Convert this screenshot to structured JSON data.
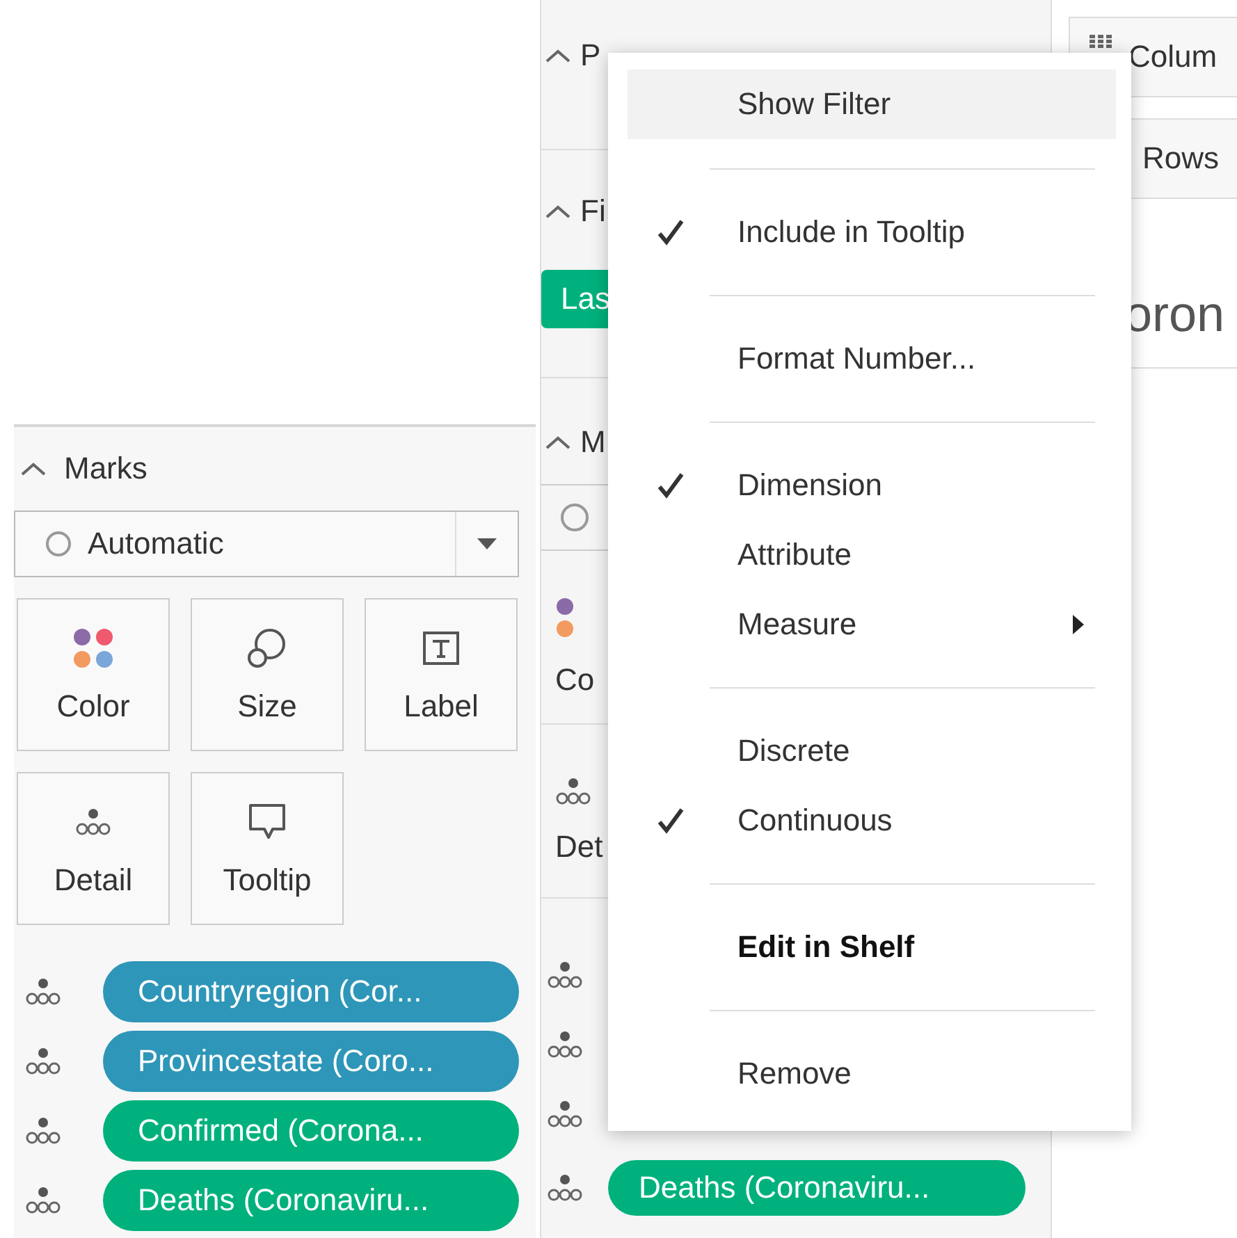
{
  "marks_panel": {
    "title": "Marks",
    "mark_type": "Automatic",
    "cards": [
      {
        "kind": "color",
        "label": "Color"
      },
      {
        "kind": "size",
        "label": "Size"
      },
      {
        "kind": "label",
        "label": "Label"
      },
      {
        "kind": "detail",
        "label": "Detail"
      },
      {
        "kind": "tooltip",
        "label": "Tooltip"
      }
    ],
    "pills": [
      {
        "text": "Countryregion (Cor...",
        "color": "#2e96b8"
      },
      {
        "text": "Provincestate (Coro...",
        "color": "#2e96b8"
      },
      {
        "text": "Confirmed (Corona...",
        "color": "#00b17d"
      },
      {
        "text": "Deaths (Coronaviru...",
        "color": "#00b17d"
      }
    ]
  },
  "background": {
    "pages_title": "P",
    "filters_title": "Fi",
    "filter_pill": "Las",
    "marks_title": "M",
    "cards": [
      {
        "kind": "color",
        "label": "Co"
      },
      {
        "kind": "detail",
        "label": "Det"
      }
    ],
    "pills": [
      {
        "text": "Deaths (Coronaviru...",
        "color": "#00b17d"
      }
    ],
    "shelves": [
      {
        "kind": "columns",
        "label": "Colum"
      },
      {
        "kind": "rows",
        "label": "Rows"
      }
    ],
    "view_title": "oron"
  },
  "context_menu": {
    "sections": [
      {
        "items": [
          {
            "label": "Show Filter",
            "selected": true,
            "checked": false,
            "bold": false,
            "submenu": false
          }
        ]
      },
      {
        "items": [
          {
            "label": "Include in Tooltip",
            "selected": false,
            "checked": true,
            "bold": false,
            "submenu": false
          }
        ]
      },
      {
        "items": [
          {
            "label": "Format Number...",
            "selected": false,
            "checked": false,
            "bold": false,
            "submenu": false
          }
        ]
      },
      {
        "items": [
          {
            "label": "Dimension",
            "selected": false,
            "checked": true,
            "bold": false,
            "submenu": false
          },
          {
            "label": "Attribute",
            "selected": false,
            "checked": false,
            "bold": false,
            "submenu": false
          },
          {
            "label": "Measure",
            "selected": false,
            "checked": false,
            "bold": false,
            "submenu": true
          }
        ]
      },
      {
        "items": [
          {
            "label": "Discrete",
            "selected": false,
            "checked": false,
            "bold": false,
            "submenu": false
          },
          {
            "label": "Continuous",
            "selected": false,
            "checked": true,
            "bold": false,
            "submenu": false
          }
        ]
      },
      {
        "items": [
          {
            "label": "Edit in Shelf",
            "selected": false,
            "checked": false,
            "bold": true,
            "submenu": false
          }
        ]
      },
      {
        "items": [
          {
            "label": "Remove",
            "selected": false,
            "checked": false,
            "bold": false,
            "submenu": false
          }
        ]
      }
    ]
  }
}
